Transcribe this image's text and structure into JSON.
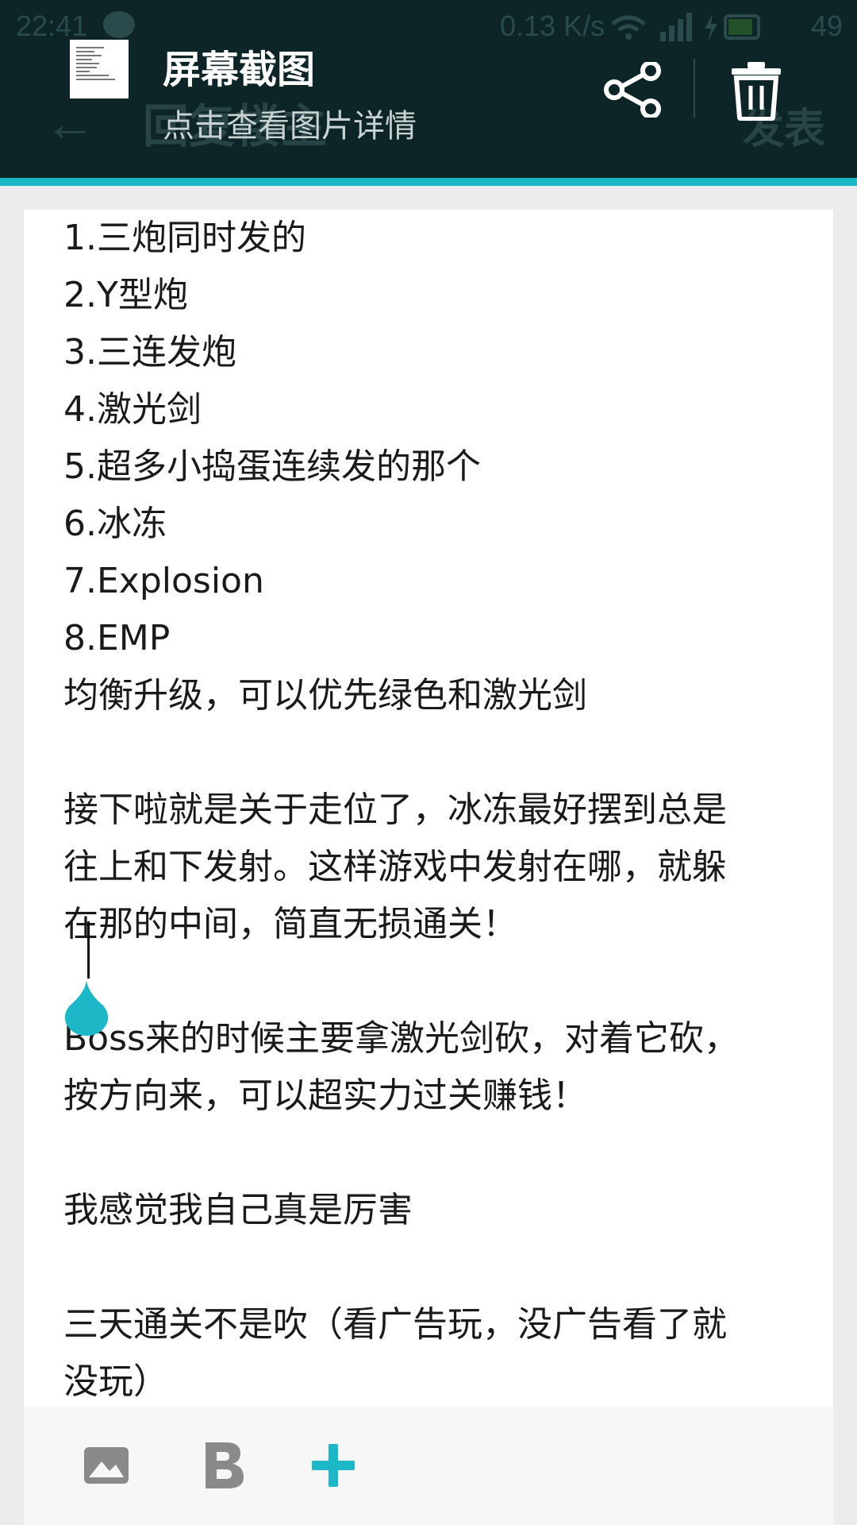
{
  "status_bar": {
    "time": "22:41",
    "net_speed": "0.13 K/s",
    "battery_level": "49"
  },
  "app_header": {
    "back_icon": "arrow-left-icon",
    "title": "回复楼主",
    "post_label": "发表"
  },
  "screenshot_notice": {
    "title": "屏幕截图",
    "subtitle": "点击查看图片详情",
    "share_icon": "share-icon",
    "delete_icon": "trash-icon"
  },
  "editor": {
    "lines": [
      "1.三炮同时发的",
      "2.Y型炮",
      "3.三连发炮",
      "4.激光剑",
      "5.超多小捣蛋连续发的那个",
      "6.冰冻",
      "7.Explosion",
      "8.EMP",
      "均衡升级，可以优先绿色和激光剑",
      "",
      "接下啦就是关于走位了，冰冻最好摆到总是",
      "往上和下发射。这样游戏中发射在哪，就躲",
      "在那的中间，简直无损通关！",
      "",
      "Boss来的时候主要拿激光剑砍，对着它砍，",
      "按方向来，可以超实力过关赚钱！",
      "",
      "我感觉我自己真是厉害",
      "",
      "三天通关不是吹（看广告玩，没广告看了就",
      "没玩）"
    ],
    "cursor_color": "#1db8c8"
  },
  "toolbar": {
    "image_icon": "image-icon",
    "bold_icon": "bold-icon",
    "add_icon": "plus-icon",
    "accent_color": "#1db8c8"
  }
}
